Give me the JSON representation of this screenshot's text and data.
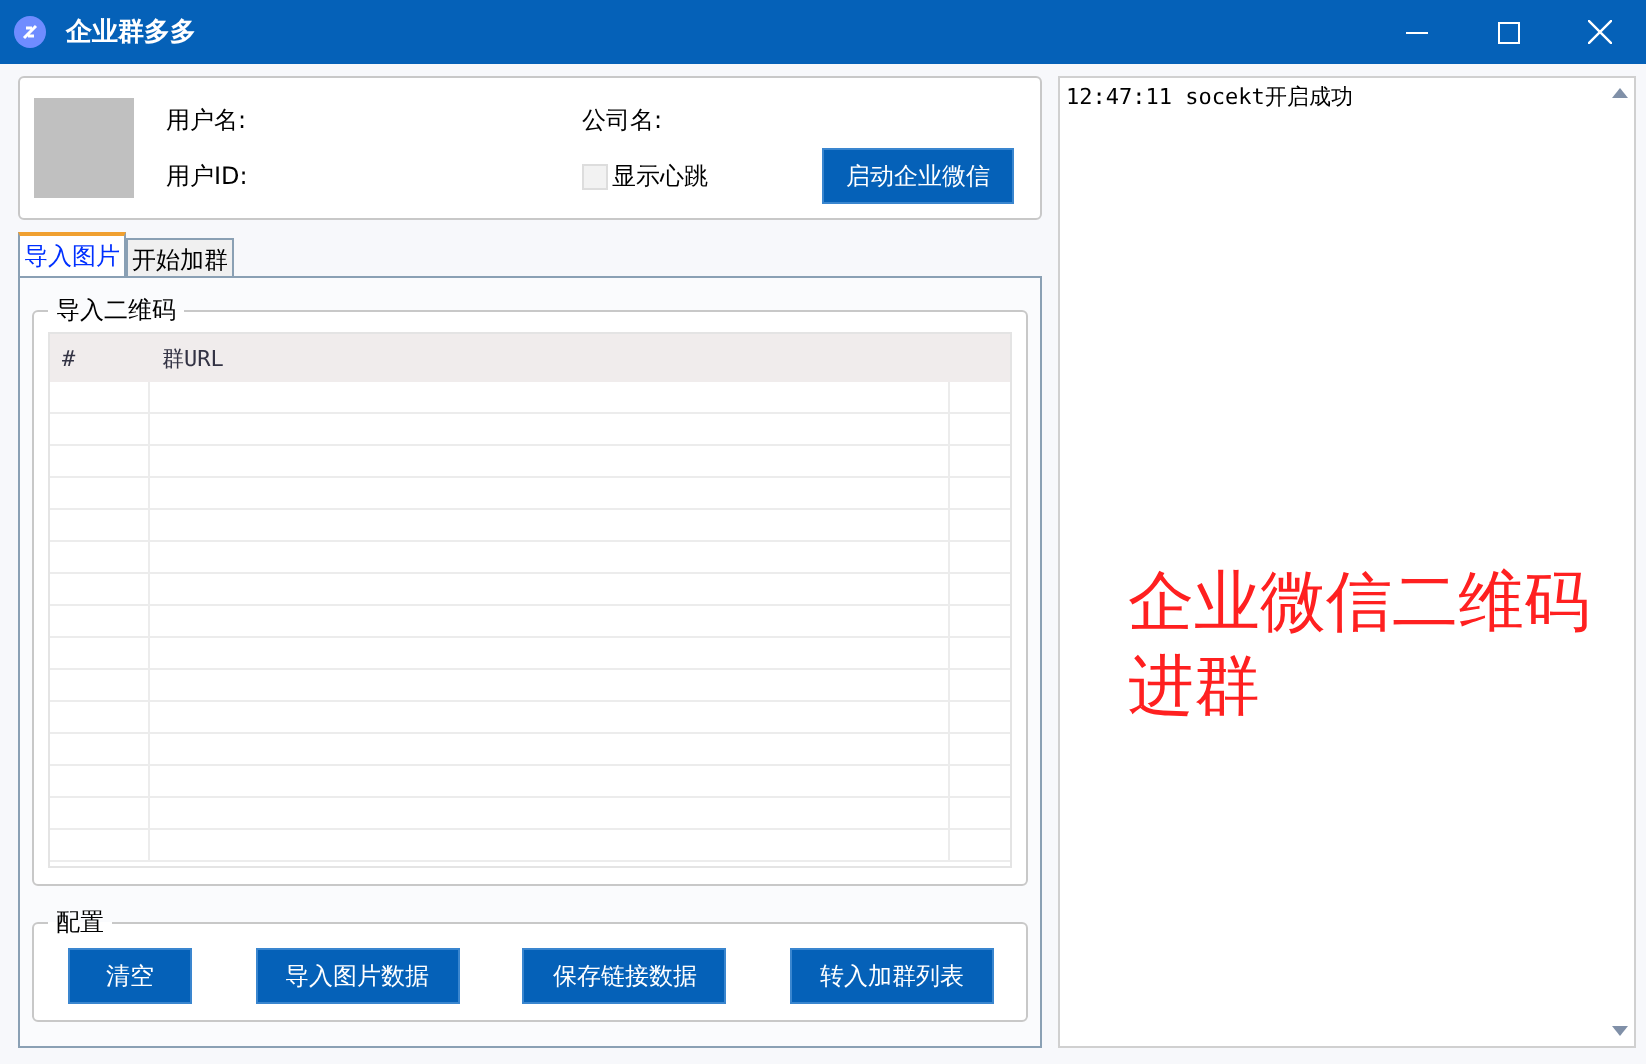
{
  "window": {
    "title": "企业群多多"
  },
  "profile": {
    "user_name_label": "用户名:",
    "user_id_label": "用户ID:",
    "company_label": "公司名:",
    "heartbeat": {
      "label": "显示心跳",
      "checked": false
    },
    "start_button": "启动企业微信"
  },
  "tabs": [
    {
      "label": "导入图片",
      "selected": true
    },
    {
      "label": "开始加群",
      "selected": false
    }
  ],
  "qr_group": {
    "title": "导入二维码",
    "table": {
      "columns": [
        "#",
        "群URL"
      ]
    }
  },
  "config_group": {
    "title": "配置",
    "buttons": [
      "清空",
      "导入图片数据",
      "保存链接数据",
      "转入加群列表"
    ]
  },
  "log": {
    "lines": [
      "12:47:11 socekt开启成功"
    ]
  },
  "annotation": "企业微信二维码进群"
}
